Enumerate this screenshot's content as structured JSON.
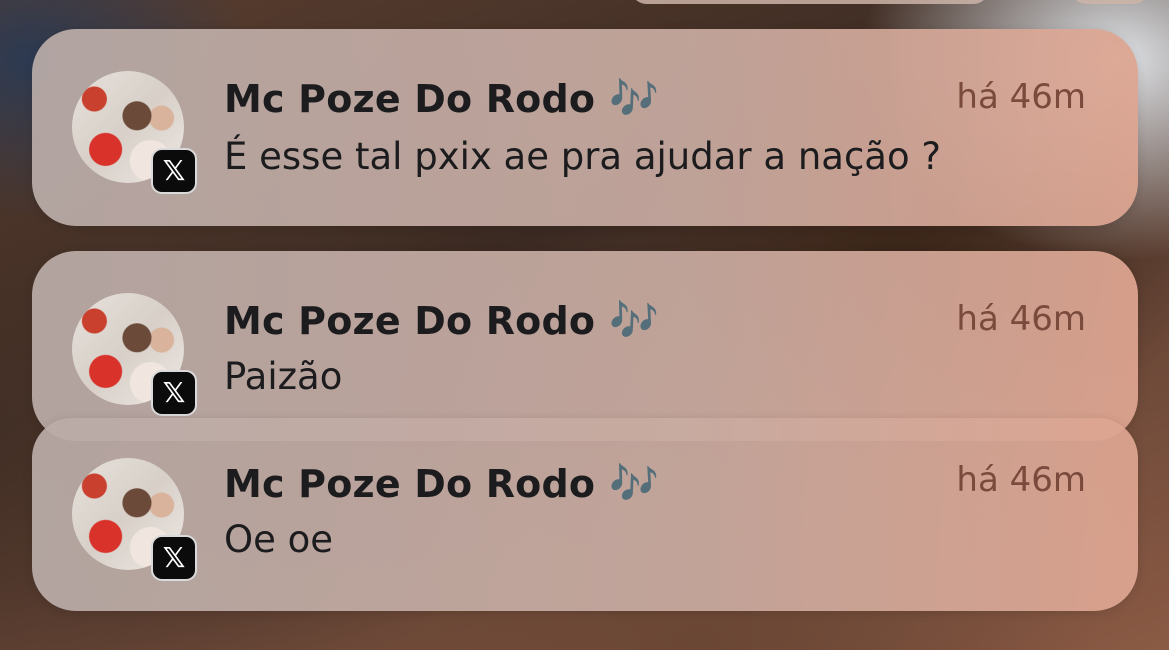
{
  "notifications": [
    {
      "app_icon": "x-logo-icon",
      "sender": "Mc Poze Do Rodo",
      "sender_emoji": "🎶",
      "time": "há 46m",
      "message": "É esse tal pxix ae pra ajudar a nação ?",
      "badge_glyph": "𝕏"
    },
    {
      "app_icon": "x-logo-icon",
      "sender": "Mc Poze Do Rodo",
      "sender_emoji": "🎶",
      "time": "há 46m",
      "message": "Paizão",
      "badge_glyph": "𝕏"
    },
    {
      "app_icon": "x-logo-icon",
      "sender": "Mc Poze Do Rodo",
      "sender_emoji": "🎶",
      "time": "há 46m",
      "message": "Oe oe",
      "badge_glyph": "𝕏"
    }
  ],
  "colors": {
    "time_text": "#7a4a3c",
    "primary_text": "#1c1c1e",
    "badge_bg": "#0b0b0b"
  }
}
